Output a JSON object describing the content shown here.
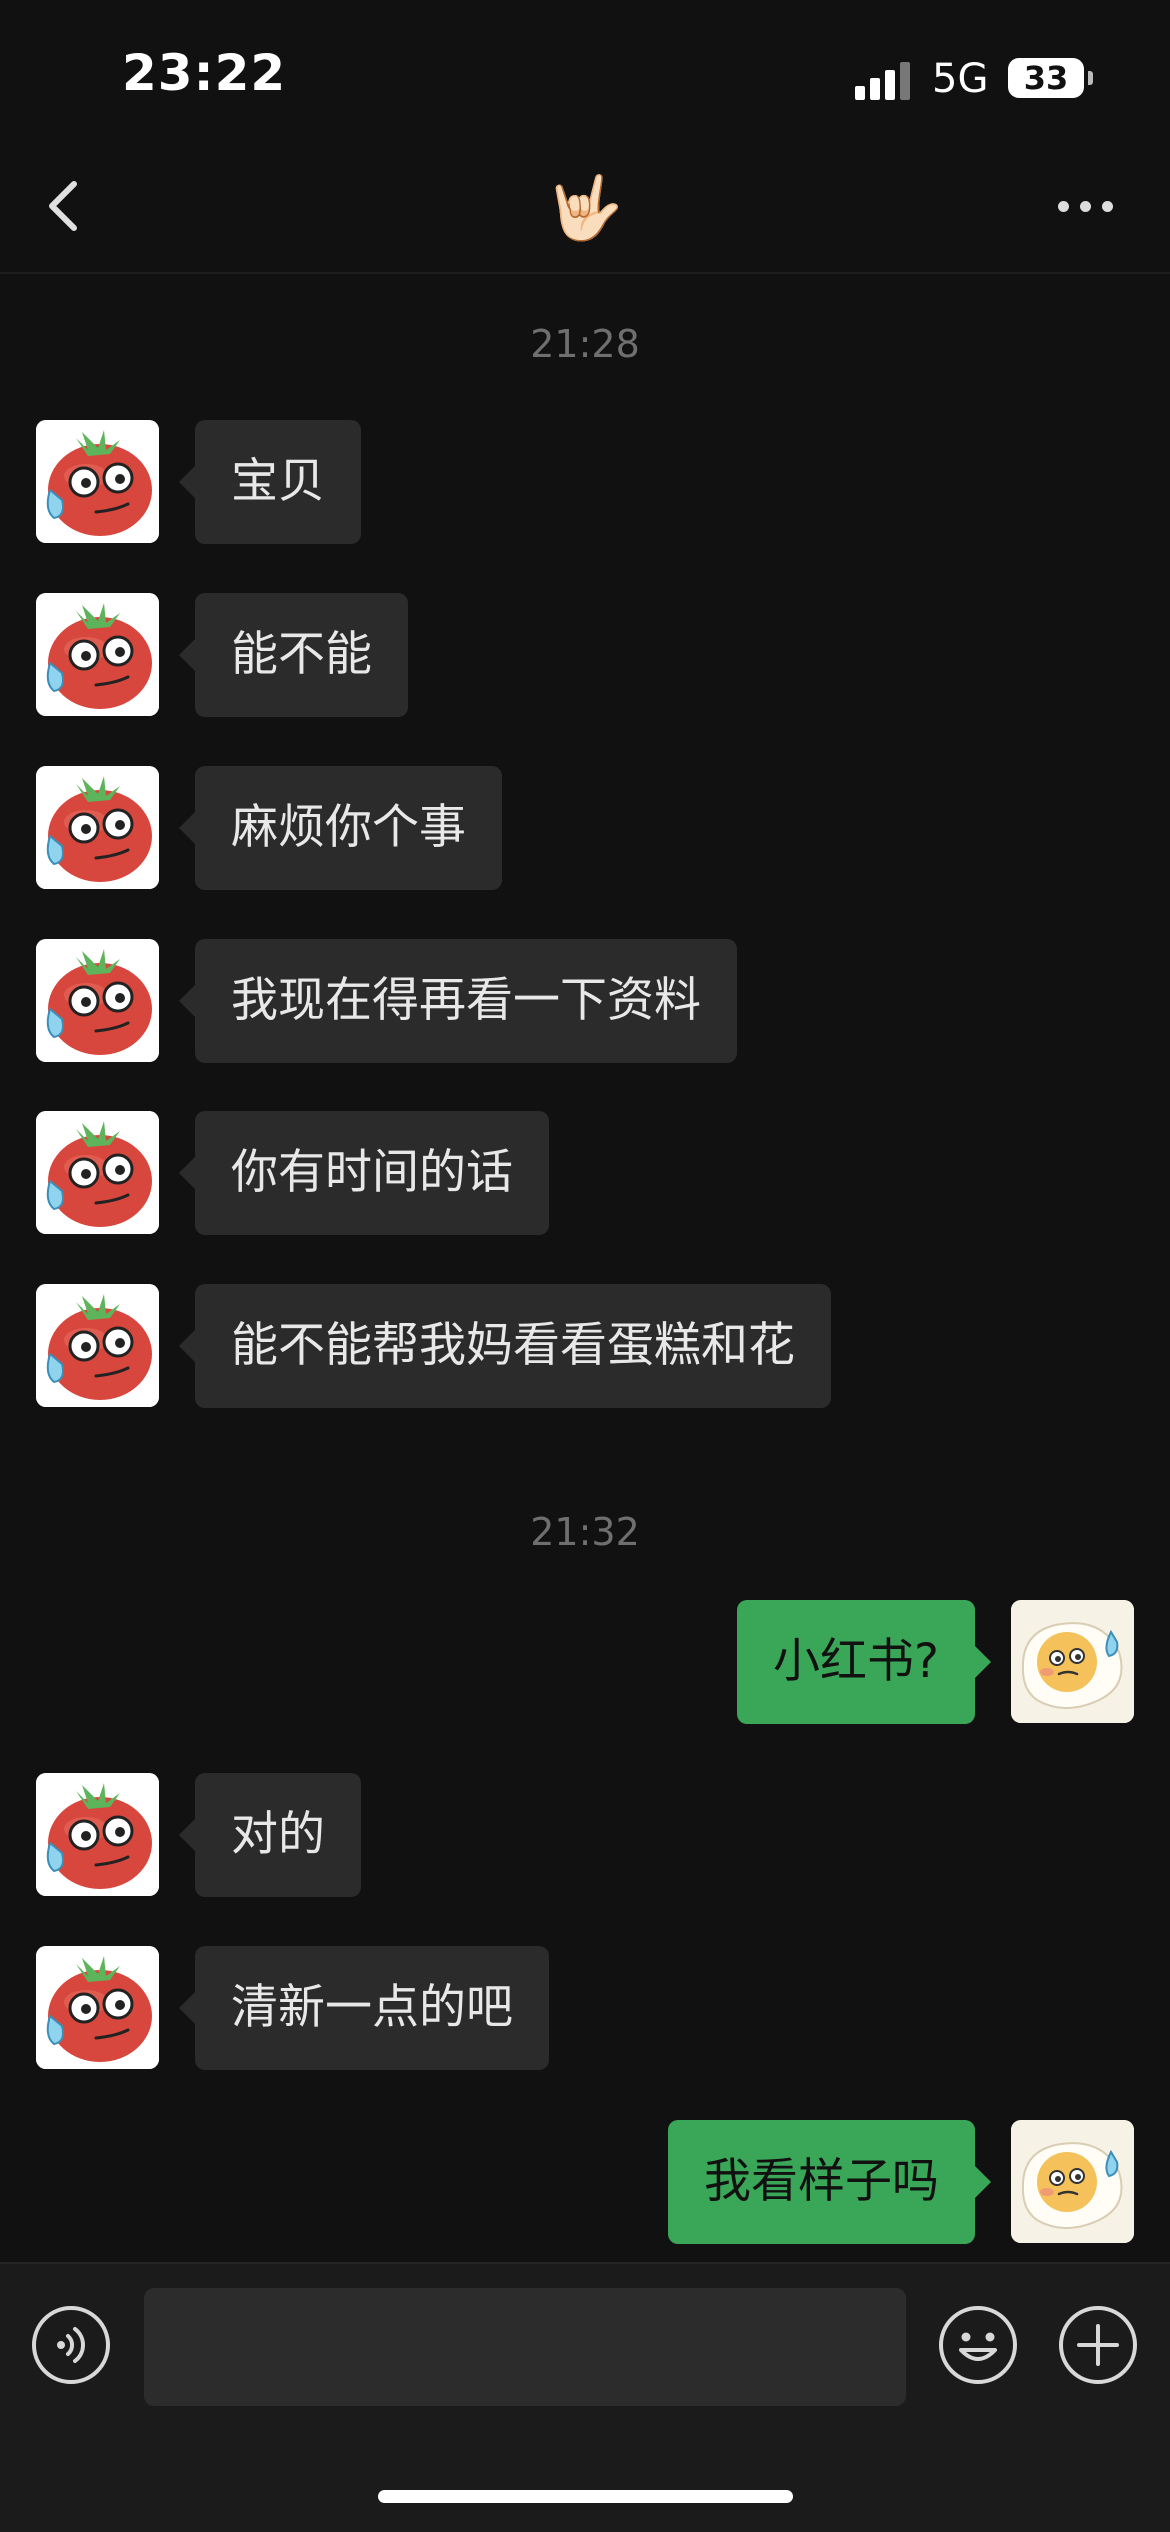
{
  "status_bar": {
    "time": "23:22",
    "network": "5G",
    "battery": "33"
  },
  "nav": {
    "title_emoji": "🤟🏻",
    "back_icon": "chevron-left-icon",
    "more_icon": "more-dots-icon"
  },
  "messages": [
    {
      "type": "timestamp",
      "text": "21:28"
    },
    {
      "type": "in",
      "text": "宝贝",
      "avatar": "tomato-avatar"
    },
    {
      "type": "in",
      "text": "能不能",
      "avatar": "tomato-avatar"
    },
    {
      "type": "in",
      "text": "麻烦你个事",
      "avatar": "tomato-avatar"
    },
    {
      "type": "in",
      "text": "我现在得再看一下资料",
      "avatar": "tomato-avatar"
    },
    {
      "type": "in",
      "text": "你有时间的话",
      "avatar": "tomato-avatar"
    },
    {
      "type": "in",
      "text": "能不能帮我妈看看蛋糕和花",
      "avatar": "tomato-avatar"
    },
    {
      "type": "timestamp",
      "text": "21:32"
    },
    {
      "type": "out",
      "text": "小红书?",
      "avatar": "egg-avatar"
    },
    {
      "type": "in",
      "text": "对的",
      "avatar": "tomato-avatar"
    },
    {
      "type": "in",
      "text": "清新一点的吧",
      "avatar": "tomato-avatar"
    },
    {
      "type": "out",
      "text": "我看样子吗",
      "avatar": "egg-avatar"
    }
  ],
  "input_bar": {
    "placeholder": "",
    "value": "",
    "voice_icon": "voice-icon",
    "emoji_icon": "emoji-icon",
    "plus_icon": "plus-icon"
  },
  "colors": {
    "background": "#111111",
    "incoming_bubble": "#2b2b2b",
    "outgoing_bubble": "#3aa758",
    "timestamp": "#6f6f6f"
  }
}
